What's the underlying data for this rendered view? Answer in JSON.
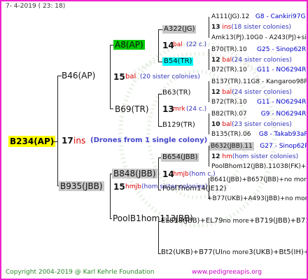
{
  "header": {
    "date": "7-  4-2019 (  23:  18)"
  },
  "footer": {
    "copyright": "Copyright 2004-2019 @ Karl Kehrle Foundation",
    "site": "www.pedigreeapis.org"
  },
  "root": {
    "label": "B234(AP)",
    "num": "17",
    "trait": "ins",
    "note": "(Drones from 1 single colony)"
  },
  "gen1": [
    {
      "label": "B46(AP)",
      "num": "15",
      "trait": "bal",
      "sis": "(20 sister colonies)"
    },
    {
      "label": "B935(JBB)",
      "num": "15",
      "trait": "hmjb",
      "sis": "(hom sister colonies)"
    }
  ],
  "gen2": [
    {
      "label": "A8(AP)",
      "num": "14",
      "trait": "bal",
      "sis": "(22 c.)"
    },
    {
      "label": "B69(TR)",
      "num": "13",
      "trait": "mrk",
      "sis": "(24 c.)"
    },
    {
      "label": "B848(JBB)",
      "num": "14",
      "trait": "hmjb",
      "sis": "(hom c.)"
    },
    {
      "label": "PoolB1hom113JBB)"
    }
  ],
  "gen3": [
    {
      "label": "A322(JG)"
    },
    {
      "label": "B54(TR)"
    },
    {
      "label": "B63(TR)"
    },
    {
      "label": "B129(TR)"
    },
    {
      "label": "B654(JBB)"
    },
    {
      "label": "PoolThom14(JE12)"
    },
    {
      "label": "EL818(JBB)+EL79",
      "suffix": "no more",
      "tail": "+B719(JBB)+B717"
    },
    {
      "label": "Bt2(UKB)+B77(UI",
      "suffix": "no more",
      "tail": "3(UKB)+Bt5(IH)+Bt"
    }
  ],
  "gen4": [
    {
      "id": "A111(JG).12",
      "code": "G8 - Cankiri97G"
    },
    {
      "num": "13",
      "trait": "ins",
      "sis": "(18 sister colonies)"
    },
    {
      "id": "Amk13(PJ).10G0 - A243(PJ)+si"
    },
    {
      "id": "B70(TR).10",
      "code": "G25 - Sinop62R"
    },
    {
      "num": "12",
      "trait": "bal",
      "sis": "(24 sister colonies)"
    },
    {
      "id": "B72(TR).10",
      "code": "G11 - NO6294R"
    },
    {
      "id": "B137(TR).11G8 - Kangaroo98R"
    },
    {
      "num": "12",
      "trait": "bal",
      "sis": "(24 sister colonies)"
    },
    {
      "id": "B72(TR).10",
      "code": "G11 - NO6294R"
    },
    {
      "id": "B82(TR).07",
      "code": "G9 - NO6294R"
    },
    {
      "num": "10",
      "trait": "bal",
      "sis": "(23 sister colonies)"
    },
    {
      "id": "B135(TR).06",
      "code": "G8 - Takab93aR"
    },
    {
      "id": "B632(JBB).11",
      "code": "G27 - Sinop62R"
    },
    {
      "num": "12",
      "trait": "hm",
      "sis": "(hom sister colonies)"
    },
    {
      "id": "PoolBhom12(JBB).11038(FK)+3"
    },
    {
      "id": "B641(JBB)+B657(JBB)+no more"
    },
    {
      "id": "+B77(UKB)+A493(JBB)+no more"
    }
  ]
}
